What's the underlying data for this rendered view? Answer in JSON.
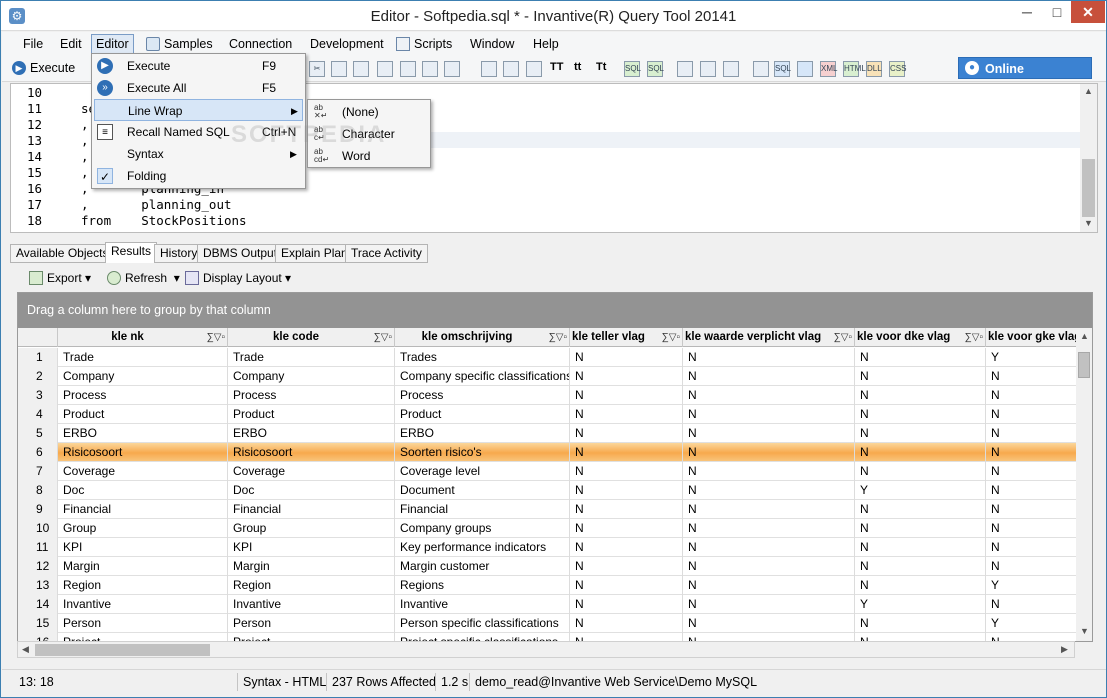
{
  "window": {
    "title": "Editor - Softpedia.sql * - Invantive(R) Query Tool 20141",
    "minimize_glyph": "─",
    "maximize_glyph": "□",
    "close_glyph": "✕"
  },
  "menubar": [
    "File",
    "Edit",
    "Editor",
    "Samples",
    "Connection",
    "Development",
    "Scripts",
    "Window",
    "Help"
  ],
  "toolbar": {
    "execute_label": "Execute",
    "text_buttons": [
      "TT",
      "tt",
      "Tt"
    ],
    "export_icons": [
      "SQL",
      "SQL",
      "SQL",
      "XML",
      "HTML",
      "DLL",
      "CSS"
    ],
    "online_label": "Online Assistance"
  },
  "editor": {
    "lines": [
      {
        "n": "10",
        "code": ""
      },
      {
        "n": "11",
        "code": "se"
      },
      {
        "n": "12",
        "code": ","
      },
      {
        "n": "13",
        "code": ","
      },
      {
        "n": "14",
        "code": ","
      },
      {
        "n": "15",
        "code": ","
      },
      {
        "n": "16",
        "code": ",       planning_in"
      },
      {
        "n": "17",
        "code": ",       planning_out"
      },
      {
        "n": "18",
        "code": "from    StockPositions"
      }
    ]
  },
  "editor_menu": {
    "items": [
      {
        "label": "Execute",
        "shortcut": "F9",
        "icon": "execute-icon"
      },
      {
        "label": "Execute All",
        "shortcut": "F5",
        "icon": "execute-all-icon"
      },
      {
        "label": "Line Wrap",
        "shortcut": "",
        "icon": "",
        "arrow": "▶"
      },
      {
        "label": "Recall Named SQL",
        "shortcut": "Ctrl+N",
        "icon": "recall-sql-icon"
      },
      {
        "label": "Syntax",
        "shortcut": "",
        "icon": "",
        "arrow": "▶"
      },
      {
        "label": "Folding",
        "shortcut": "",
        "icon": "check-icon"
      }
    ],
    "check_glyph": "✓"
  },
  "line_wrap_menu": {
    "items": [
      "(None)",
      "Character",
      "Word"
    ]
  },
  "watermark": "SOFTPEDIA",
  "tabs": [
    "Available Objects",
    "Results",
    "History",
    "DBMS Output",
    "Explain Plan",
    "Trace Activity"
  ],
  "results_toolbar": {
    "export": "Export",
    "refresh": "Refresh",
    "display_layout": "Display Layout"
  },
  "grid": {
    "group_hint": "Drag a column here to group by that column",
    "header_icons": "∑▽▫",
    "columns": [
      "kle nk",
      "kle code",
      "kle omschrijving",
      "kle teller vlag",
      "kle waarde verplicht vlag",
      "kle voor dke vlag",
      "kle voor gke vlag"
    ],
    "rows": [
      [
        "1",
        "Trade",
        "Trade",
        "Trades",
        "N",
        "N",
        "N",
        "Y"
      ],
      [
        "2",
        "Company",
        "Company",
        "Company specific classifications",
        "N",
        "N",
        "N",
        "N"
      ],
      [
        "3",
        "Process",
        "Process",
        "Process",
        "N",
        "N",
        "N",
        "N"
      ],
      [
        "4",
        "Product",
        "Product",
        "Product",
        "N",
        "N",
        "N",
        "N"
      ],
      [
        "5",
        "ERBO",
        "ERBO",
        "ERBO",
        "N",
        "N",
        "N",
        "N"
      ],
      [
        "6",
        "Risicosoort",
        "Risicosoort",
        "Soorten risico's",
        "N",
        "N",
        "N",
        "N"
      ],
      [
        "7",
        "Coverage",
        "Coverage",
        "Coverage level",
        "N",
        "N",
        "N",
        "N"
      ],
      [
        "8",
        "Doc",
        "Doc",
        "Document",
        "N",
        "N",
        "Y",
        "N"
      ],
      [
        "9",
        "Financial",
        "Financial",
        "Financial",
        "N",
        "N",
        "N",
        "N"
      ],
      [
        "10",
        "Group",
        "Group",
        "Company groups",
        "N",
        "N",
        "N",
        "N"
      ],
      [
        "11",
        "KPI",
        "KPI",
        "Key performance indicators",
        "N",
        "N",
        "N",
        "N"
      ],
      [
        "12",
        "Margin",
        "Margin",
        "Margin customer",
        "N",
        "N",
        "N",
        "N"
      ],
      [
        "13",
        "Region",
        "Region",
        "Regions",
        "N",
        "N",
        "N",
        "Y"
      ],
      [
        "14",
        "Invantive",
        "Invantive",
        "Invantive",
        "N",
        "N",
        "Y",
        "N"
      ],
      [
        "15",
        "Person",
        "Person",
        "Person specific classifications",
        "N",
        "N",
        "N",
        "Y"
      ],
      [
        "16",
        "Project",
        "Project",
        "Project specific classifications",
        "N",
        "N",
        "N",
        "N"
      ]
    ],
    "selected_row": 6
  },
  "status": {
    "position": "13: 18",
    "syntax": "Syntax - HTML",
    "rows": "237 Rows Affected",
    "time": "1.2 s",
    "connection": "demo_read@Invantive Web Service\\Demo MySQL"
  }
}
